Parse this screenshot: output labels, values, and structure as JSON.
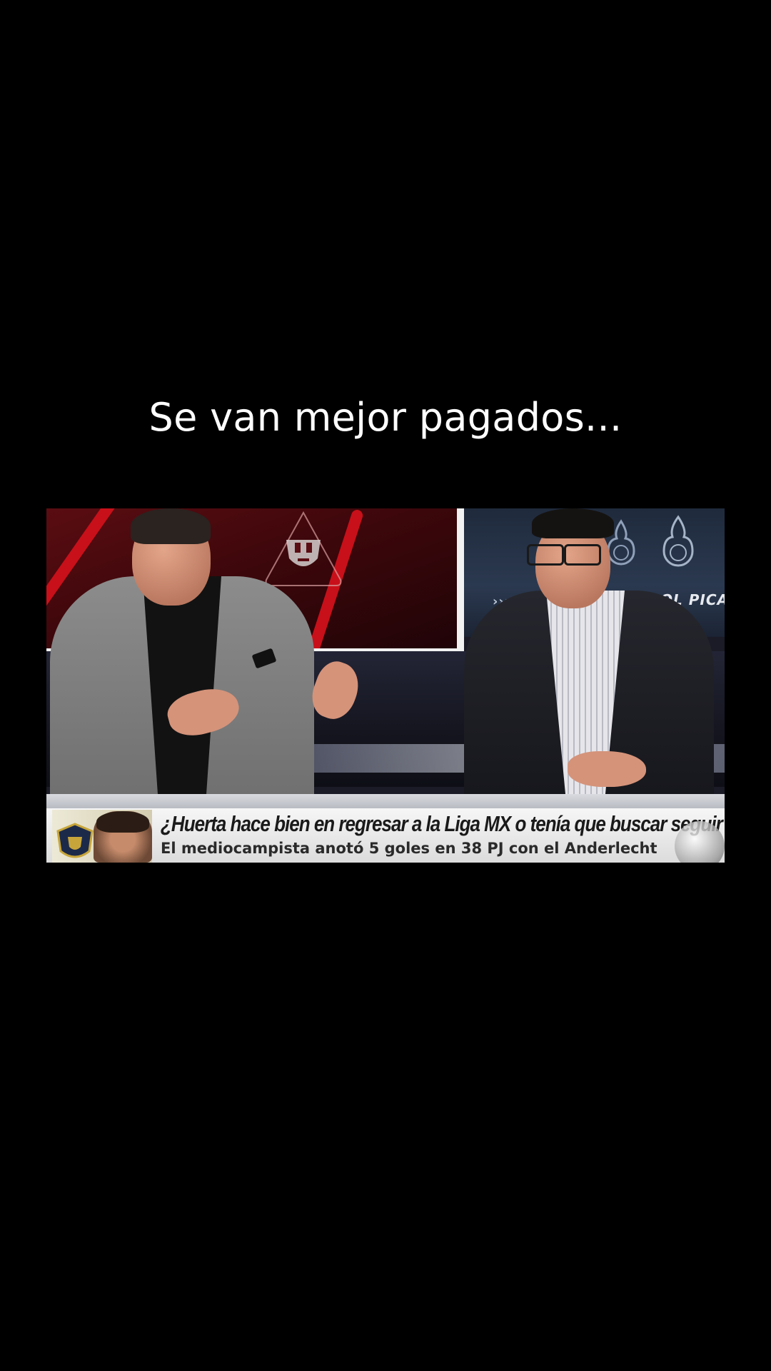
{
  "caption": {
    "text": "Se van mejor pagados..."
  },
  "broadcast": {
    "backdrop_brand": "FUTBOL PICA",
    "chevrons": "››››",
    "lower_third": {
      "question": "¿Huerta hace bien en regresar a la Liga MX o tenía que buscar seguir en Europa?",
      "subtitle": "El mediocampista anotó 5 goles en 38 PJ con el Anderlecht"
    }
  },
  "colors": {
    "background": "#000000",
    "caption_text": "#ffffff",
    "backdrop_red": "#c8101a",
    "backdrop_blue": "#2b3950"
  }
}
